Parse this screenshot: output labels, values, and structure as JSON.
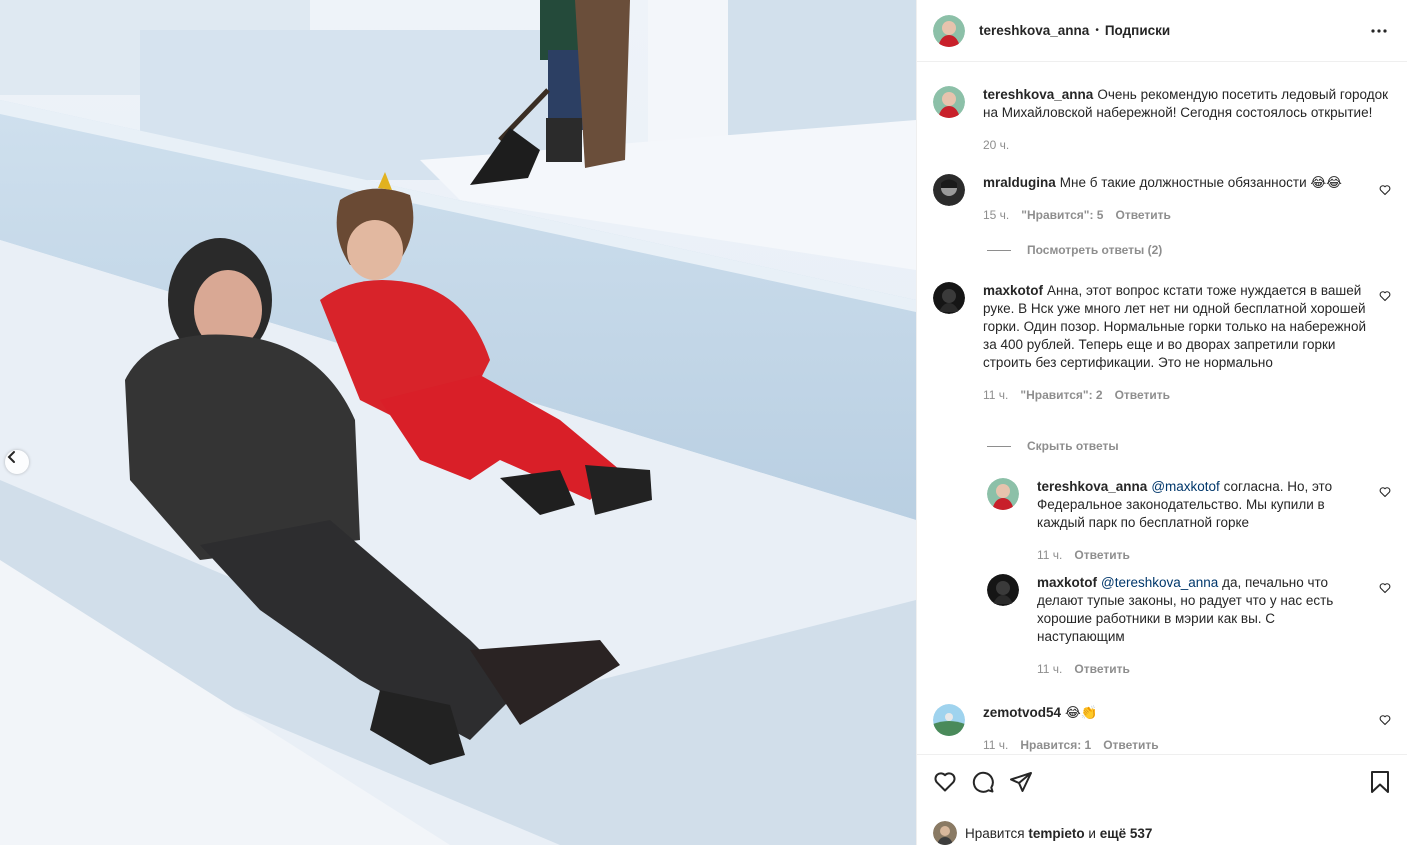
{
  "header": {
    "username": "tereshkova_anna",
    "separator": "•",
    "follow_label": "Подписки",
    "more_icon": "more-horizontal-icon"
  },
  "caption": {
    "username": "tereshkova_anna",
    "text": "Очень рекомендую посетить ледовый городок на Михайловской набережной! Сегодня состоялось открытие!",
    "time": "20 ч."
  },
  "comments": [
    {
      "username": "mraldugina",
      "text": "Мне б такие должностные обязанности 😂😂",
      "time": "15 ч.",
      "likes": "\"Нравится\": 5",
      "reply": "Ответить",
      "view_replies": "Посмотреть ответы (2)"
    },
    {
      "username": "maxkotof",
      "text": "Анна, этот вопрос кстати тоже нуждается в вашей руке. В Нск уже много лет нет ни одной бесплатной хорошей горки. Один позор. Нормальные горки только на набережной за 400 рублей. Теперь еще и во дворах запретили горки строить без сертификации. Это не нормально",
      "time": "11 ч.",
      "likes": "\"Нравится\": 2",
      "reply": "Ответить",
      "hide_replies": "Скрыть ответы",
      "replies": [
        {
          "username": "tereshkova_anna",
          "mention": "@maxkotof",
          "text": "согласна. Но, это Федеральное законодательство. Мы купили в каждый парк по бесплатной горке",
          "time": "11 ч.",
          "reply": "Ответить"
        },
        {
          "username": "maxkotof",
          "mention": "@tereshkova_anna",
          "text": "да, печально что делают тупые законы, но радует что у нас есть хорошие работники в мэрии как вы. С наступающим",
          "time": "11 ч.",
          "reply": "Ответить"
        }
      ]
    },
    {
      "username": "zemotvod54",
      "text": "😂👏",
      "time": "11 ч.",
      "likes": "Нравится: 1",
      "reply": "Ответить"
    }
  ],
  "likes": {
    "prefix": "Нравится",
    "user": "tempieto",
    "conj": "и",
    "count_text": "ещё 537"
  },
  "icons": {
    "like": "heart-icon",
    "comment": "comment-icon",
    "share": "paper-plane-icon",
    "save": "bookmark-icon",
    "carousel_prev": "chevron-left-icon"
  },
  "colors": {
    "text": "#262626",
    "muted": "#8e8e8e",
    "link": "#00376b",
    "border": "#efefef"
  }
}
